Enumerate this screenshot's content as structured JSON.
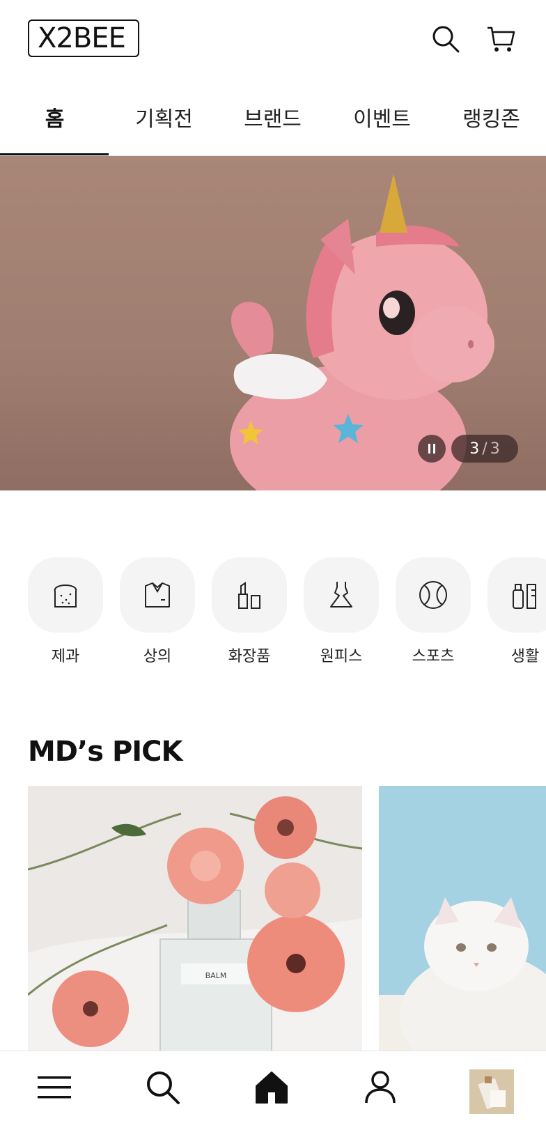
{
  "header": {
    "logo_text": "X2BEE",
    "search_icon": "search-icon",
    "cart_icon": "cart-icon"
  },
  "tabs": [
    {
      "label": "홈",
      "active": true
    },
    {
      "label": "기획전",
      "active": false
    },
    {
      "label": "브랜드",
      "active": false
    },
    {
      "label": "이벤트",
      "active": false
    },
    {
      "label": "랭킹존",
      "active": false
    }
  ],
  "banner": {
    "current": "3",
    "separator": "/",
    "total": "3",
    "pause_icon": "pause-icon"
  },
  "categories": [
    {
      "label": "제과",
      "icon": "bread-icon"
    },
    {
      "label": "상의",
      "icon": "shirt-icon"
    },
    {
      "label": "화장품",
      "icon": "cosmetics-icon"
    },
    {
      "label": "원피스",
      "icon": "dress-icon"
    },
    {
      "label": "스포츠",
      "icon": "ball-icon"
    },
    {
      "label": "생활",
      "icon": "household-icon"
    }
  ],
  "mds_pick": {
    "title": "MD’s PICK",
    "perfume_label": "BALM"
  },
  "bottom_nav": {
    "items": [
      "menu-icon",
      "search-icon",
      "home-icon",
      "user-icon",
      "recent-product-thumbnail"
    ]
  },
  "colors": {
    "banner_bg": "#a98677",
    "unicorn_pink": "#e8a1a8",
    "category_bg": "#f4f4f4"
  }
}
